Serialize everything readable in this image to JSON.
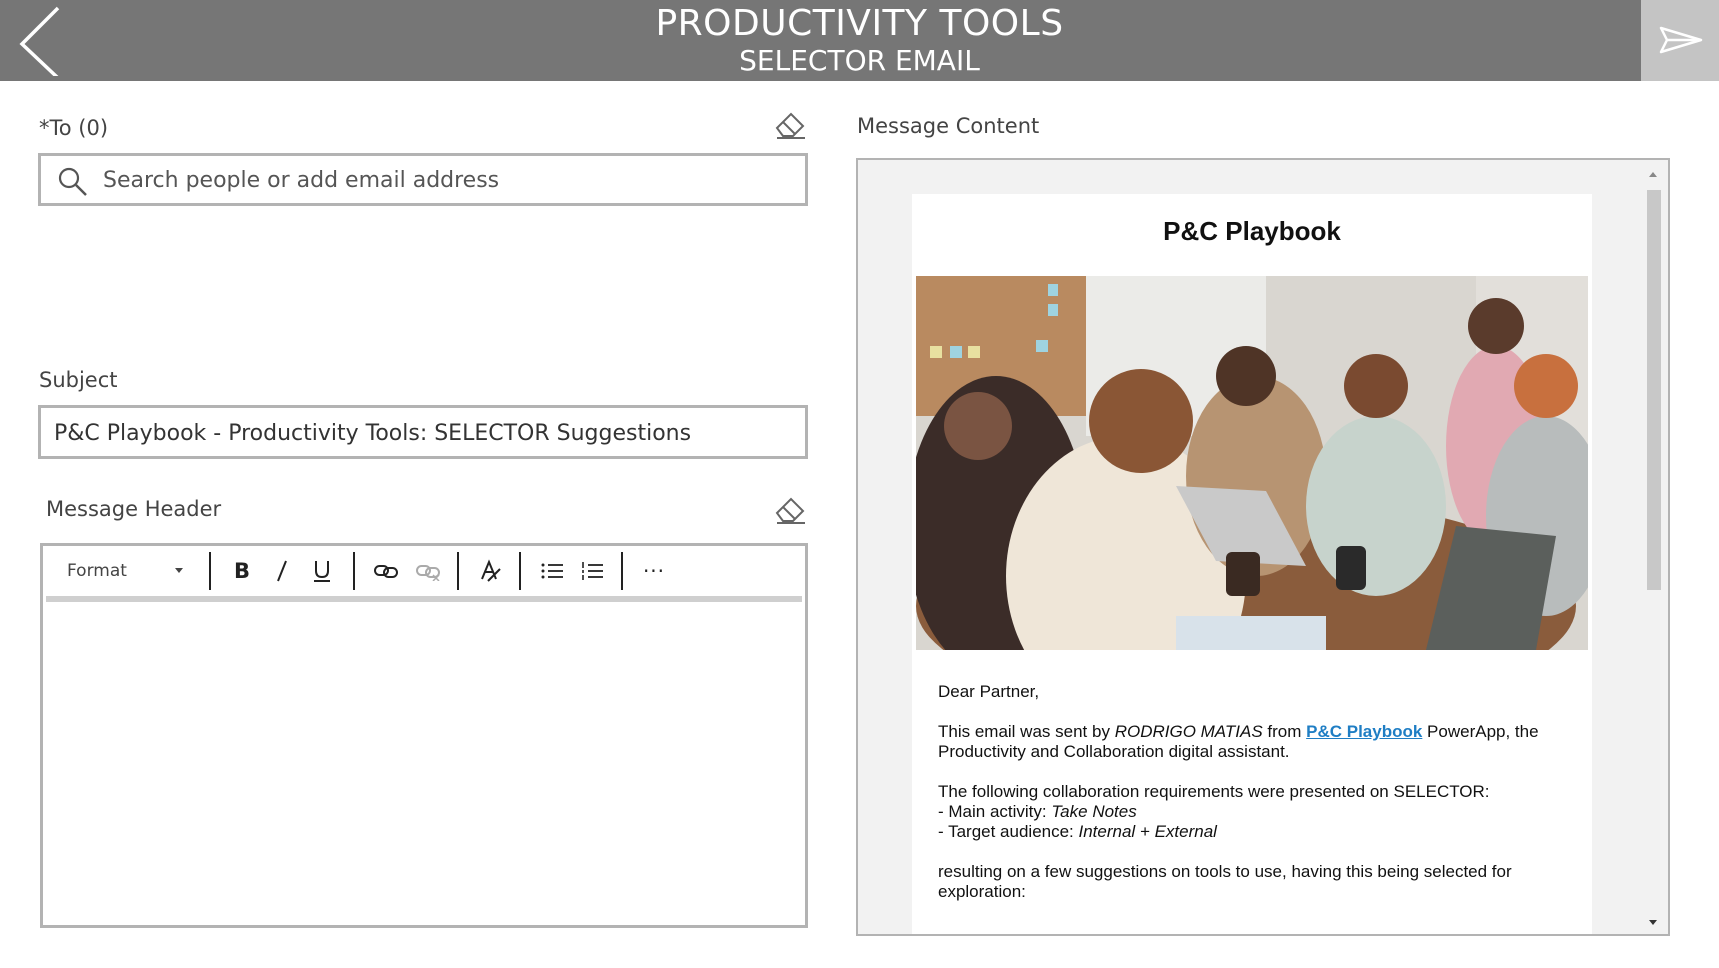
{
  "header": {
    "title": "PRODUCTIVITY TOOLS",
    "subtitle": "SELECTOR EMAIL",
    "background_color": "#767676",
    "back_icon": "chevron-left-icon",
    "send_icon": "send-icon"
  },
  "to": {
    "label": "*To (0)",
    "placeholder": "Search people or add email address",
    "search_icon": "search-icon",
    "clear_icon": "eraser-icon"
  },
  "subject": {
    "label": "Subject",
    "value": "P&C Playbook - Productivity Tools: SELECTOR Suggestions"
  },
  "message_header": {
    "label": "Message Header",
    "clear_icon": "eraser-icon",
    "toolbar": {
      "format_label": "Format",
      "buttons": [
        "bold",
        "italic",
        "underline",
        "insert-link",
        "remove-link",
        "clear-formatting",
        "bulleted-list",
        "numbered-list",
        "more"
      ]
    }
  },
  "message_content": {
    "label": "Message Content",
    "email_title": "P&C Playbook",
    "greeting": "Dear Partner,",
    "sent_by_prefix": "This email was sent by ",
    "sender_name": "RODRIGO MATIAS",
    "from_word": " from ",
    "app_link": "P&C Playbook",
    "sent_by_suffix": " PowerApp, the Productivity and Collaboration digital assistant.",
    "requirements_intro": "The following collaboration requirements were presented on SELECTOR:",
    "main_activity_label": "- Main activity: ",
    "main_activity_value": "Take Notes",
    "audience_label": "- Target audience: ",
    "audience_value": "Internal + External",
    "result_text": "resulting on a few suggestions on tools to use, having this being selected for exploration:",
    "link_color": "#1f7ec4"
  }
}
